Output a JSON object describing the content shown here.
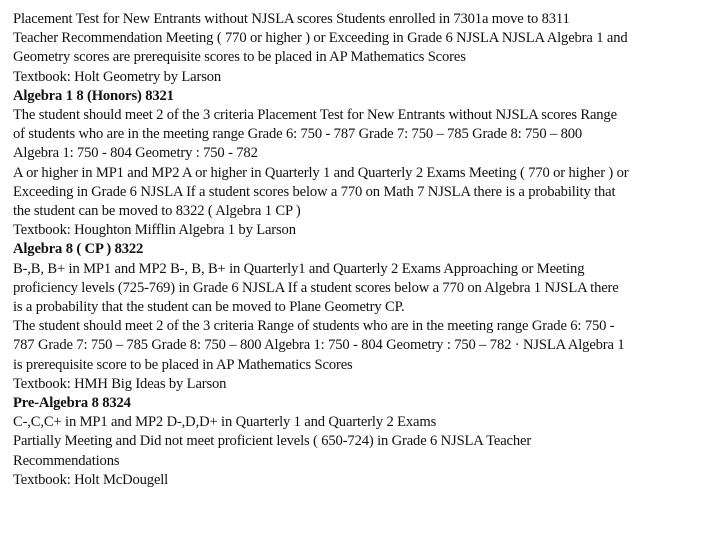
{
  "document": {
    "sections": [
      {
        "id": "geometry-honors",
        "heading": null,
        "lines": [
          "Placement Test for New Entrants without NJSLA scores Students enrolled in 7301a move to 8311",
          "Teacher Recommendation Meeting ( 770 or higher ) or Exceeding in Grade 6 NJSLA NJSLA Algebra 1 and",
          "Geometry scores are prerequisite scores to be placed in AP Mathematics Scores",
          "Textbook: Holt Geometry by Larson"
        ]
      },
      {
        "id": "algebra-1-8-honors",
        "heading": "Algebra 1 8 (Honors) 8321",
        "lines": [
          "The student should meet 2 of the 3 criteria Placement Test for New Entrants without NJSLA scores Range",
          "of students who are in the meeting range Grade 6: 750 - 787 Grade 7: 750 – 785 Grade 8: 750 – 800",
          "Algebra 1: 750 - 804 Geometry : 750 - 782",
          "A or higher in MP1 and MP2 A or higher in Quarterly 1 and Quarterly 2 Exams Meeting ( 770 or higher ) or",
          "Exceeding in Grade 6 NJSLA If a student scores below a 770 on Math 7 NJSLA there is a probability that",
          "the student can be moved to 8322 ( Algebra 1 CP )",
          "Textbook: Houghton Mifflin Algebra 1 by Larson"
        ]
      },
      {
        "id": "algebra-8-cp",
        "heading": "Algebra 8 ( CP ) 8322",
        "lines": [
          "B-,B, B+ in MP1 and MP2 B-, B, B+ in Quarterly1 and Quarterly 2 Exams Approaching or Meeting",
          "proficiency levels (725-769) in Grade 6 NJSLA If a student scores below a 770 on Algebra 1 NJSLA there",
          "is a probability that the student can be moved to Plane Geometry CP.",
          "The student should meet 2 of the 3 criteria Range of students who are in the meeting range Grade 6: 750 -",
          "787 Grade 7: 750 – 785 Grade 8: 750 – 800 Algebra 1: 750 - 804 Geometry : 750 – 782 · NJSLA Algebra 1",
          "is prerequisite score to be placed in AP Mathematics Scores",
          "Textbook: HMH Big Ideas by Larson"
        ]
      },
      {
        "id": "pre-algebra-8",
        "heading": "Pre-Algebra 8 8324",
        "lines": [
          "C-,C,C+ in MP1 and MP2 D-,D,D+ in Quarterly 1 and Quarterly 2 Exams",
          "Partially Meeting and Did not meet proficient levels ( 650-724) in Grade 6 NJSLA Teacher",
          "Recommendations",
          "Textbook: Holt McDougell"
        ]
      }
    ]
  }
}
